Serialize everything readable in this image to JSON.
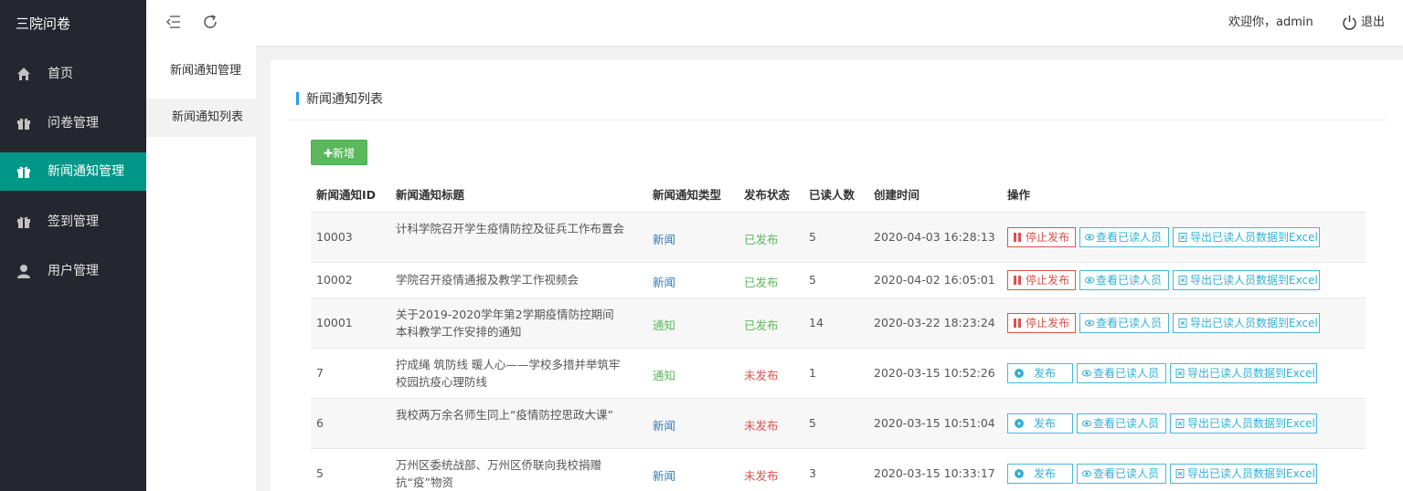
{
  "app": {
    "title": "三院问卷"
  },
  "sidebar": {
    "items": [
      {
        "label": "首页",
        "icon": "home-icon"
      },
      {
        "label": "问卷管理",
        "icon": "gift-icon"
      },
      {
        "label": "新闻通知管理",
        "icon": "gift-icon",
        "active": true
      },
      {
        "label": "签到管理",
        "icon": "gift-icon"
      },
      {
        "label": "用户管理",
        "icon": "user-icon"
      }
    ]
  },
  "header": {
    "welcome": "欢迎你，admin",
    "logout": "退出"
  },
  "subnav": {
    "title": "新闻通知管理",
    "item": "新闻通知列表"
  },
  "panel": {
    "title": "新闻通知列表",
    "add_label": "✚新增"
  },
  "table": {
    "headers": [
      "新闻通知ID",
      "新闻通知标题",
      "新闻通知类型",
      "发布状态",
      "已读人数",
      "创建时间",
      "操作"
    ],
    "rows": [
      {
        "id": "10003",
        "title": "计科学院召开学生疫情防控及征兵工作布置会",
        "type": "新闻",
        "status": "已发布",
        "reads": "5",
        "time": "2020-04-03 16:28:13",
        "action": "停止发布"
      },
      {
        "id": "10002",
        "title": "学院召开疫情通报及教学工作视频会",
        "type": "新闻",
        "status": "已发布",
        "reads": "5",
        "time": "2020-04-02 16:05:01",
        "action": "停止发布"
      },
      {
        "id": "10001",
        "title": "关于2019-2020学年第2学期疫情防控期间本科教学工作安排的通知",
        "type": "通知",
        "status": "已发布",
        "reads": "14",
        "time": "2020-03-22 18:23:24",
        "action": "停止发布"
      },
      {
        "id": "7",
        "title": "拧成绳 筑防线 暖人心——学校多措并举筑牢校园抗疫心理防线",
        "type": "通知",
        "status": "未发布",
        "reads": "1",
        "time": "2020-03-15 10:52:26",
        "action": "发布"
      },
      {
        "id": "6",
        "title": "我校两万余名师生同上“疫情防控思政大课”",
        "type": "新闻",
        "status": "未发布",
        "reads": "5",
        "time": "2020-03-15 10:51:04",
        "action": "发布"
      },
      {
        "id": "5",
        "title": "万州区委统战部、万州区侨联向我校捐赠抗“疫”物资",
        "type": "新闻",
        "status": "未发布",
        "reads": "3",
        "time": "2020-03-15 10:33:17",
        "action": "发布"
      }
    ],
    "view_label": "查看已读人员",
    "export_label": "导出已读人员数据到Excel"
  },
  "colors": {
    "sidebar_bg": "#24272f",
    "active_bg": "#009688",
    "published": "#5cb85c",
    "unpublished": "#d9534f",
    "news_type": "#337ab7",
    "button_green": "#5cb85c"
  }
}
